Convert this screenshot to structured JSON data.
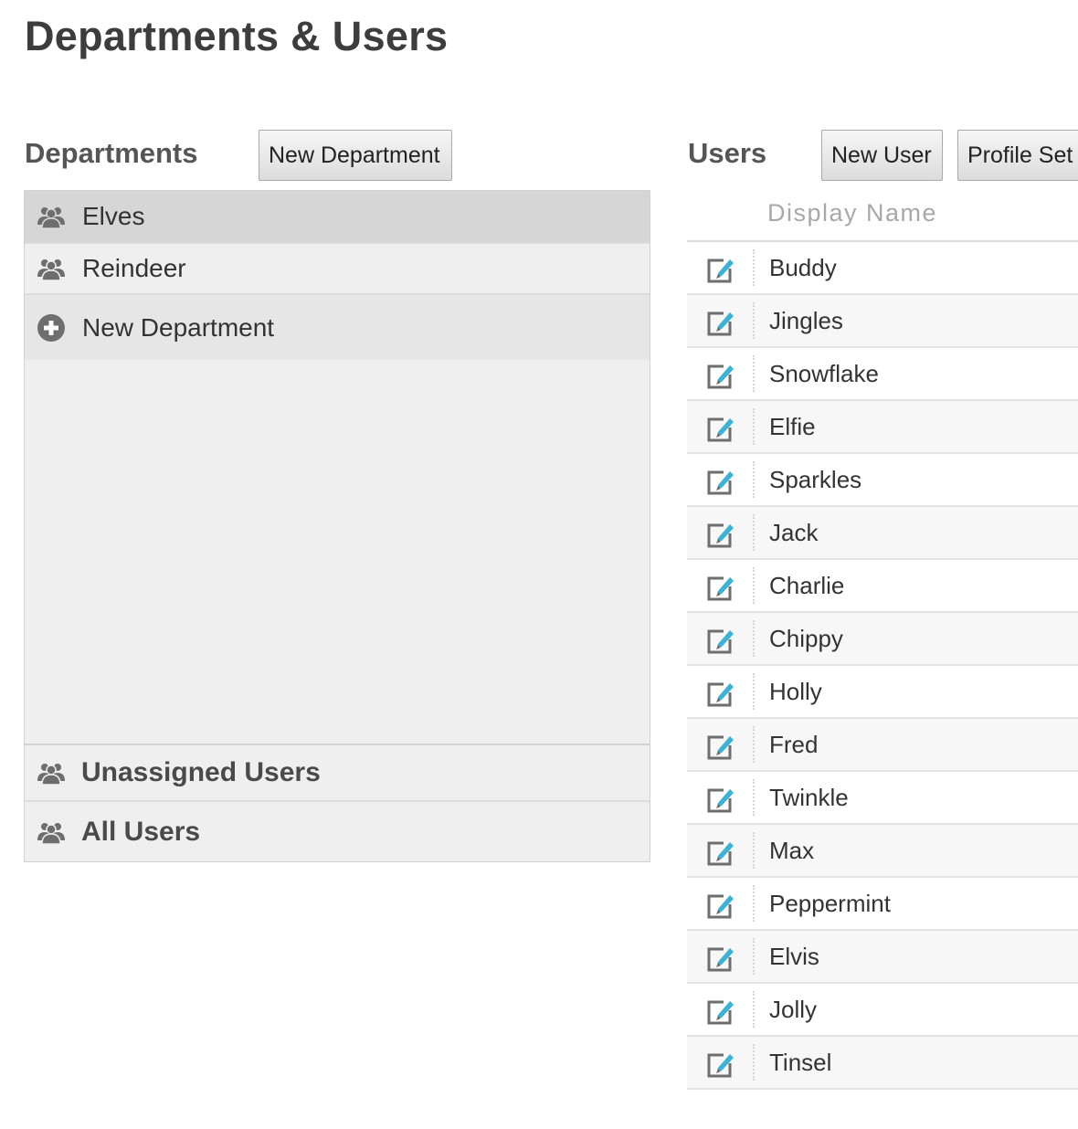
{
  "page": {
    "title": "Departments & Users"
  },
  "departments": {
    "title": "Departments",
    "new_button_label": "New Department",
    "items": [
      {
        "label": "Elves",
        "icon": "group-icon",
        "selected": true
      },
      {
        "label": "Reindeer",
        "icon": "group-icon",
        "selected": false
      }
    ],
    "new_item": {
      "label": "New Department",
      "icon": "add-circle-icon"
    },
    "footer_items": [
      {
        "label": "Unassigned Users",
        "icon": "group-icon"
      },
      {
        "label": "All Users",
        "icon": "group-icon"
      }
    ]
  },
  "users": {
    "title": "Users",
    "new_button_label": "New User",
    "profile_button_label": "Profile Set",
    "column_header": "Display Name",
    "rows": [
      {
        "name": "Buddy"
      },
      {
        "name": "Jingles"
      },
      {
        "name": "Snowflake"
      },
      {
        "name": "Elfie"
      },
      {
        "name": "Sparkles"
      },
      {
        "name": "Jack"
      },
      {
        "name": "Charlie"
      },
      {
        "name": "Chippy"
      },
      {
        "name": "Holly"
      },
      {
        "name": "Fred"
      },
      {
        "name": "Twinkle"
      },
      {
        "name": "Max"
      },
      {
        "name": "Peppermint"
      },
      {
        "name": "Elvis"
      },
      {
        "name": "Jolly"
      },
      {
        "name": "Tinsel"
      }
    ]
  },
  "colors": {
    "edit_icon_accent": "#3bb3d8",
    "icon_gray": "#6e6e6e",
    "selected_row": "#d6d6d6",
    "panel_bg": "#efefef"
  }
}
